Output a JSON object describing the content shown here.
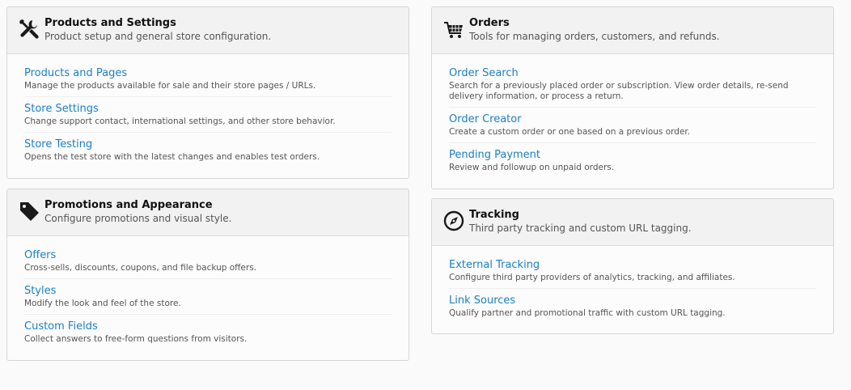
{
  "cards": [
    {
      "icon": "tools-icon",
      "title": "Products and Settings",
      "subtitle": "Product setup and general store configuration.",
      "items": [
        {
          "label": "Products and Pages",
          "description": "Manage the products available for sale and their store pages / URLs."
        },
        {
          "label": "Store Settings",
          "description": "Change support contact, international settings, and other store behavior."
        },
        {
          "label": "Store Testing",
          "description": "Opens the test store with the latest changes and enables test orders."
        }
      ]
    },
    {
      "icon": "tag-icon",
      "title": "Promotions and Appearance",
      "subtitle": "Configure promotions and visual style.",
      "items": [
        {
          "label": "Offers",
          "description": "Cross-sells, discounts, coupons, and file backup offers."
        },
        {
          "label": "Styles",
          "description": "Modify the look and feel of the store."
        },
        {
          "label": "Custom Fields",
          "description": "Collect answers to free-form questions from visitors."
        }
      ]
    },
    {
      "icon": "cart-icon",
      "title": "Orders",
      "subtitle": "Tools for managing orders, customers, and refunds.",
      "items": [
        {
          "label": "Order Search",
          "description": "Search for a previously placed order or subscription. View order details, re-send delivery information, or process a return."
        },
        {
          "label": "Order Creator",
          "description": "Create a custom order or one based on a previous order."
        },
        {
          "label": "Pending Payment",
          "description": "Review and followup on unpaid orders."
        }
      ]
    },
    {
      "icon": "compass-icon",
      "title": "Tracking",
      "subtitle": "Third party tracking and custom URL tagging.",
      "items": [
        {
          "label": "External Tracking",
          "description": "Configure third party providers of analytics, tracking, and affiliates."
        },
        {
          "label": "Link Sources",
          "description": "Qualify partner and promotional traffic with custom URL tagging."
        }
      ]
    }
  ]
}
